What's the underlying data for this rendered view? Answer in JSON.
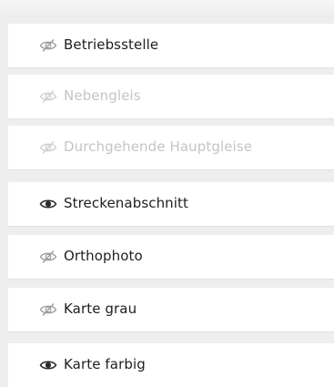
{
  "layers": [
    {
      "label": "Betriebsstelle",
      "state": "hidden",
      "icon": "eye-slash-icon"
    },
    {
      "label": "Nebengleis",
      "state": "disabled",
      "icon": "eye-slash-icon"
    },
    {
      "label": "Durchgehende Hauptgleise",
      "state": "disabled",
      "icon": "eye-slash-icon"
    },
    {
      "label": "Streckenabschnitt",
      "state": "visible",
      "icon": "eye-icon"
    },
    {
      "label": "Orthophoto",
      "state": "hidden",
      "icon": "eye-slash-icon"
    },
    {
      "label": "Karte grau",
      "state": "hidden",
      "icon": "eye-slash-icon"
    },
    {
      "label": "Karte farbig",
      "state": "visible",
      "icon": "eye-icon"
    }
  ],
  "colors": {
    "text": "#1e1e1e",
    "text_disabled": "#c4c4c4",
    "icon_hidden": "#9a9a9a",
    "icon_visible": "#2a2a2a",
    "background": "#eeeeee",
    "row_background": "#ffffff"
  }
}
